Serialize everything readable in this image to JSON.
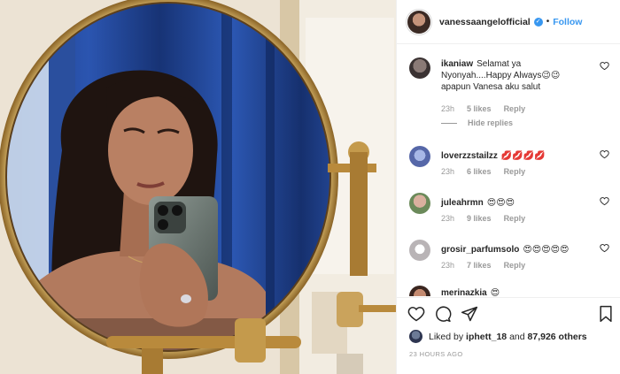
{
  "post": {
    "username": "vanessaangelofficial",
    "follow_label": "Follow",
    "separator": "•"
  },
  "comments": [
    {
      "username": "ikaniaw",
      "text": "Selamat ya Nyonyah....Happy Always😉😉 apapun Vanesa aku salut",
      "time": "23h",
      "likes": "5 likes",
      "reply": "Reply",
      "hide_replies": "Hide replies",
      "avatar_color": "#5a5150"
    },
    {
      "username": "loverzzstailzz",
      "text": "💋💋💋💋",
      "time": "23h",
      "likes": "6 likes",
      "reply": "Reply",
      "avatar_color": "#6f7fb8"
    },
    {
      "username": "juleahrmn",
      "text": "😍😍😍",
      "time": "23h",
      "likes": "9 likes",
      "reply": "Reply",
      "avatar_color": "#c79a86"
    },
    {
      "username": "grosir_parfumsolo",
      "text": "😍😍😍😍😍",
      "time": "23h",
      "likes": "7 likes",
      "reply": "Reply",
      "avatar_color": "#c8c2c4"
    },
    {
      "username": "merinazkia",
      "text": "😍",
      "avatar_color": "#8a5a4a"
    }
  ],
  "likes_bar": {
    "prefix": "Liked by",
    "user": "iphett_18",
    "middle": "and",
    "count": "87,926 others"
  },
  "time_ago": "23 HOURS AGO",
  "colors": {
    "accent": "#3897f0",
    "muted": "#999999",
    "text": "#262626"
  },
  "icons": [
    "heart-icon",
    "comment-icon",
    "share-icon",
    "bookmark-icon",
    "verified-icon"
  ]
}
